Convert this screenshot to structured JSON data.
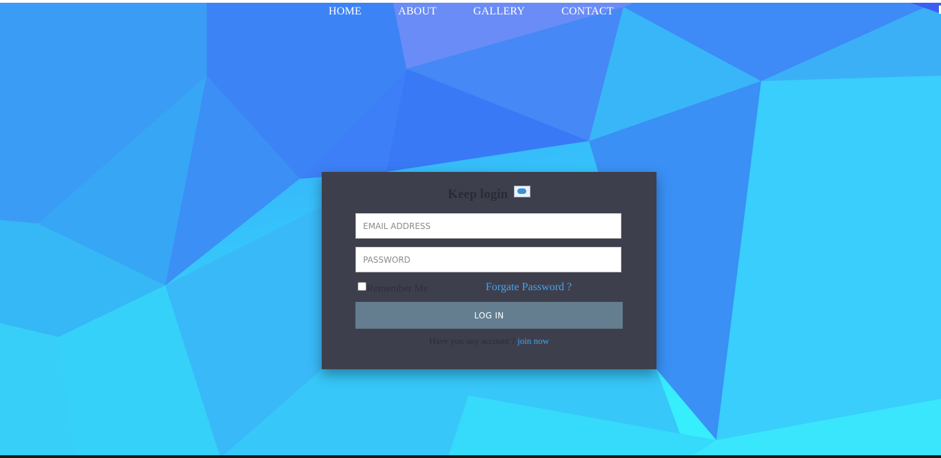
{
  "nav": {
    "items": [
      "HOME",
      "ABOUT",
      "GALLERY",
      "CONTACT"
    ]
  },
  "login": {
    "title": "Keep login",
    "email_placeholder": "EMAIL ADDRESS",
    "password_placeholder": "PASSWORD",
    "remember_label": "Remember Me",
    "remember_checked": false,
    "forgot_label": "Forgate Password ?",
    "login_button_label": "LOG IN",
    "signup_prompt": "Have you any account ?",
    "signup_link": "join now"
  },
  "colors": {
    "card_background": "#3e3f4d",
    "button_background": "#647e8f",
    "link": "#4aa3e8",
    "background_blue": "#3a8cf6",
    "background_cyan": "#37eefc"
  },
  "icons": {
    "brand": "brand-logo-icon"
  }
}
